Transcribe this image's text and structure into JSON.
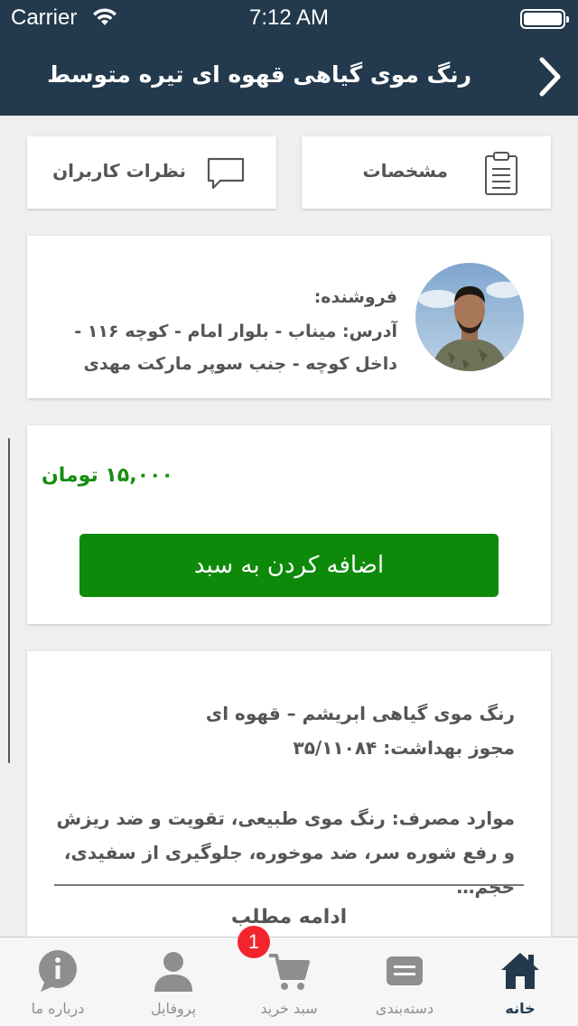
{
  "status_bar": {
    "carrier": "Carrier",
    "time": "7:12 AM"
  },
  "nav": {
    "title": "رنگ موی گیاهی قهوه ای تیره متوسط",
    "back_icon": "chevron-right-icon"
  },
  "tabs": {
    "specs": {
      "label": "مشخصات",
      "icon": "clipboard-icon"
    },
    "reviews": {
      "label": "نظرات کاربران",
      "icon": "comment-icon"
    }
  },
  "seller": {
    "label": "فروشنده:",
    "address": "آدرس: میناب - بلوار امام - کوچه ۱۱۶ - داخل کوچه - جنب سوپر مارکت مهدی"
  },
  "product": {
    "price": "۱۵,۰۰۰ تومان",
    "add_to_cart": "اضافه کردن به سبد"
  },
  "description": {
    "line1": "رنگ موی گیاهی ابریشم – قهوه ای",
    "line2": "مجوز بهداشت: ۳۵/۱۱۰۸۴",
    "line3": "موارد مصرف: رنگ موی طبیعی، تقویت و ضد ریزش و رفع شوره سر، ضد موخوره، جلوگیری از سفیدی، حجم…",
    "read_more": "ادامه مطلب"
  },
  "tab_bar": {
    "items": [
      {
        "label": "خانه",
        "icon": "home-icon",
        "active": true
      },
      {
        "label": "دسته‌بندی",
        "icon": "category-icon",
        "active": false
      },
      {
        "label": "سبد خرید",
        "icon": "cart-icon",
        "active": false,
        "badge": "1"
      },
      {
        "label": "پروفایل",
        "icon": "user-icon",
        "active": false
      },
      {
        "label": "درباره ما",
        "icon": "info-icon",
        "active": false
      }
    ]
  },
  "colors": {
    "header": "#23394d",
    "price": "#158d0f",
    "button": "#0d8a0a",
    "badge": "#f2252f",
    "active_tab": "#23394d",
    "inactive_tab": "#8e8e8e"
  }
}
